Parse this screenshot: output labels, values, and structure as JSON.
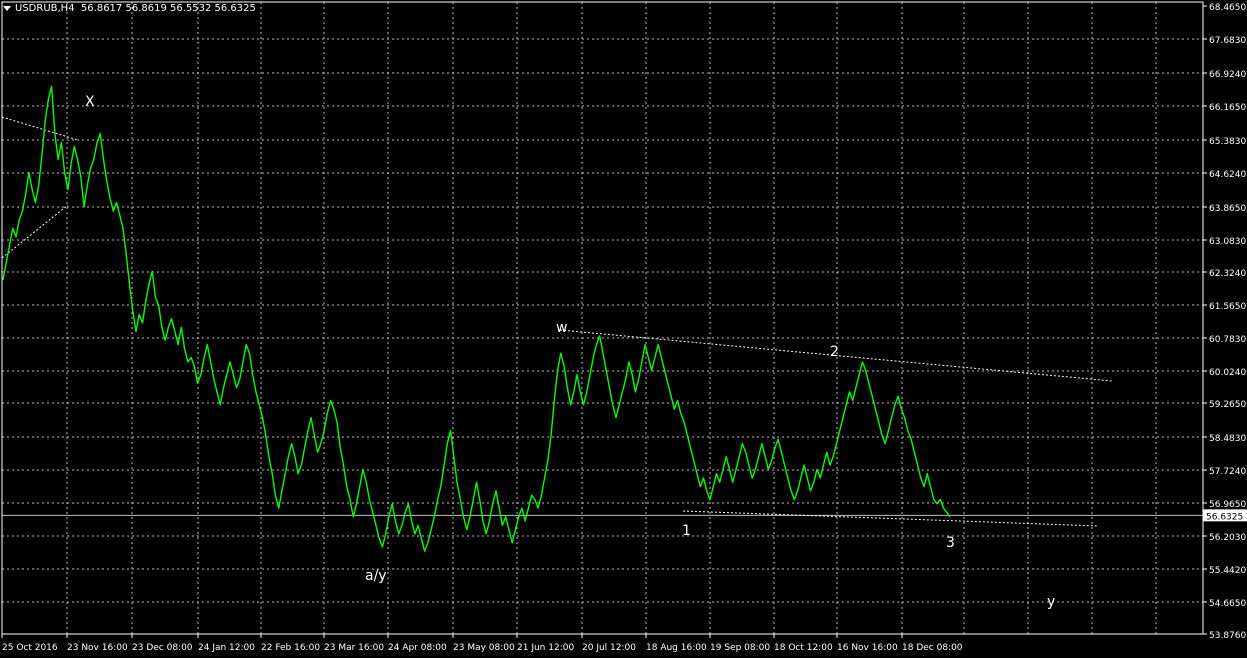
{
  "header": {
    "symbol": "USDRUB,H4",
    "ohlc": "56.8617 56.8619 56.5532 56.6325"
  },
  "colors": {
    "background": "#000000",
    "grid": "#c0c0c0",
    "price_line": "#00ff00",
    "axis": "#ffffff",
    "current_price_line": "#c0c0c0",
    "trendline": "#ffffff"
  },
  "chart_data": {
    "type": "line",
    "symbol": "USDRUB",
    "timeframe": "H4",
    "ylim": [
      53.876,
      68.465
    ],
    "yticks": [
      "68.4650",
      "67.6830",
      "66.9240",
      "66.1650",
      "65.3830",
      "64.6240",
      "63.8650",
      "63.0830",
      "62.3240",
      "61.5650",
      "60.7830",
      "60.0240",
      "59.2650",
      "58.4830",
      "57.7240",
      "56.9650",
      "56.2030",
      "55.4420",
      "54.6650",
      "53.8760"
    ],
    "xticks": [
      "25 Oct 2016",
      "23 Nov 16:00",
      "23 Dec 08:00",
      "24 Jan 12:00",
      "22 Feb 16:00",
      "23 Mar 16:00",
      "24 Apr 08:00",
      "23 May 08:00",
      "21 Jun 12:00",
      "20 Jul 12:00",
      "18 Aug 16:00",
      "19 Sep 08:00",
      "18 Oct 12:00",
      "16 Nov 16:00",
      "18 Dec 08:00"
    ],
    "current_price": "56.6325",
    "series": [
      {
        "values": [
          62.1,
          62.5,
          62.9,
          63.3,
          63.1,
          63.5,
          63.7,
          64.1,
          64.6,
          64.2,
          63.9,
          64.3,
          65.0,
          65.8,
          66.3,
          66.6,
          65.5,
          64.9,
          65.3,
          64.6,
          64.2,
          64.8,
          65.2,
          64.9,
          64.5,
          63.8,
          64.3,
          64.7,
          64.9,
          65.3,
          65.5,
          64.9,
          64.4,
          64.0,
          63.7,
          63.9,
          63.6,
          63.3,
          62.7,
          62.0,
          61.4,
          60.9,
          61.3,
          61.1,
          61.6,
          62.0,
          62.3,
          61.7,
          61.5,
          61.0,
          60.7,
          61.0,
          61.2,
          60.9,
          60.6,
          61.0,
          60.5,
          60.2,
          60.3,
          60.1,
          59.7,
          59.9,
          60.3,
          60.6,
          60.2,
          59.8,
          59.5,
          59.2,
          59.6,
          59.9,
          60.2,
          59.9,
          59.6,
          59.8,
          60.2,
          60.6,
          60.4,
          59.9,
          59.5,
          59.2,
          58.9,
          58.5,
          58.0,
          57.6,
          57.1,
          56.8,
          57.2,
          57.6,
          58.0,
          58.3,
          58.0,
          57.6,
          57.8,
          58.2,
          58.6,
          58.9,
          58.5,
          58.1,
          58.3,
          58.6,
          59.0,
          59.3,
          59.1,
          58.8,
          58.2,
          57.8,
          57.3,
          57.0,
          56.6,
          56.9,
          57.3,
          57.7,
          57.4,
          57.0,
          56.7,
          56.4,
          56.1,
          55.9,
          56.2,
          56.6,
          56.9,
          56.5,
          56.2,
          56.4,
          56.7,
          56.9,
          56.5,
          56.2,
          56.4,
          56.1,
          55.8,
          56.0,
          56.3,
          56.6,
          57.0,
          57.3,
          57.8,
          58.3,
          58.6,
          58.0,
          57.4,
          57.0,
          56.6,
          56.3,
          56.6,
          57.0,
          57.4,
          57.0,
          56.5,
          56.2,
          56.5,
          56.9,
          57.2,
          56.8,
          56.4,
          56.6,
          56.3,
          56.0,
          56.3,
          56.6,
          56.8,
          56.5,
          56.8,
          57.1,
          57.0,
          56.8,
          57.1,
          57.5,
          57.9,
          58.5,
          59.3,
          60.0,
          60.4,
          60.1,
          59.6,
          59.2,
          59.5,
          59.9,
          59.5,
          59.2,
          59.5,
          59.9,
          60.3,
          60.6,
          60.8,
          60.4,
          60.0,
          59.6,
          59.2,
          58.9,
          59.2,
          59.5,
          59.8,
          60.2,
          59.9,
          59.5,
          59.8,
          60.2,
          60.6,
          60.3,
          60.0,
          60.3,
          60.6,
          60.3,
          60.0,
          59.7,
          59.4,
          59.1,
          59.3,
          59.0,
          58.8,
          58.5,
          58.2,
          57.9,
          57.6,
          57.3,
          57.5,
          57.2,
          57.0,
          57.3,
          57.6,
          57.4,
          57.7,
          58.0,
          57.7,
          57.4,
          57.7,
          58.0,
          58.3,
          58.1,
          57.8,
          57.5,
          57.7,
          58.0,
          58.3,
          58.0,
          57.7,
          57.9,
          58.2,
          58.4,
          58.1,
          57.8,
          57.5,
          57.2,
          57.0,
          57.2,
          57.5,
          57.8,
          57.5,
          57.2,
          57.4,
          57.7,
          57.5,
          57.8,
          58.1,
          57.8,
          58.0,
          58.3,
          58.6,
          58.9,
          59.2,
          59.5,
          59.3,
          59.6,
          59.9,
          60.2,
          60.0,
          59.7,
          59.4,
          59.1,
          58.8,
          58.5,
          58.3,
          58.6,
          58.9,
          59.2,
          59.4,
          59.1,
          58.9,
          58.6,
          58.4,
          58.1,
          57.8,
          57.5,
          57.3,
          57.6,
          57.3,
          57.0,
          56.9,
          57.0,
          56.8,
          56.7,
          56.6
        ]
      }
    ],
    "annotations": [
      {
        "text": "X"
      },
      {
        "text": "a/y"
      },
      {
        "text": "w"
      },
      {
        "text": "1"
      },
      {
        "text": "2"
      },
      {
        "text": "3"
      },
      {
        "text": "y"
      }
    ]
  }
}
